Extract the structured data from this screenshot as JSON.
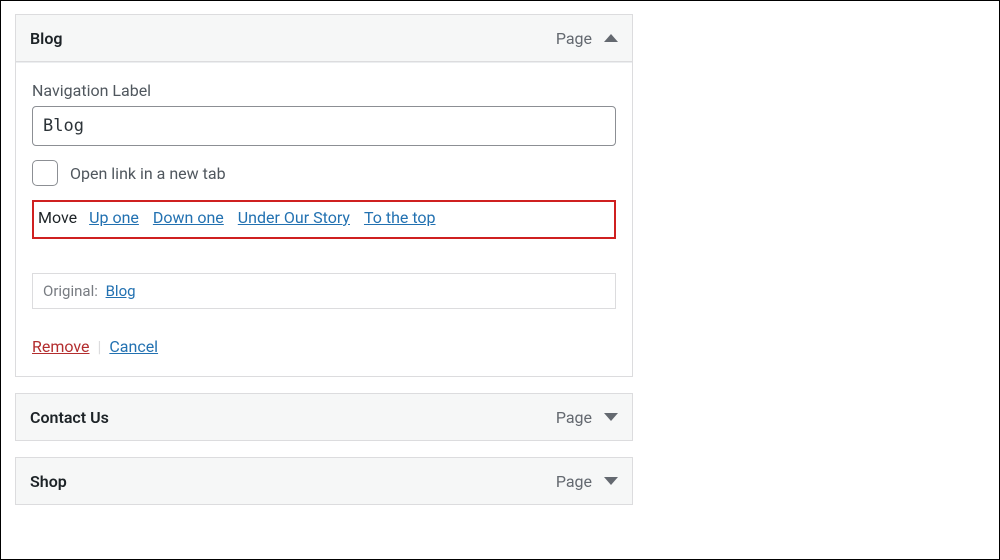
{
  "items": [
    {
      "title": "Blog",
      "type": "Page",
      "expanded": true,
      "nav_label_label": "Navigation Label",
      "nav_label_value": "Blog",
      "new_tab_label": "Open link in a new tab",
      "move_prefix": "Move",
      "move_links": {
        "up": "Up one",
        "down": "Down one",
        "under": "Under Our Story",
        "top": "To the top"
      },
      "original_prefix": "Original:",
      "original_value": "Blog",
      "remove": "Remove",
      "cancel": "Cancel"
    },
    {
      "title": "Contact Us",
      "type": "Page",
      "expanded": false
    },
    {
      "title": "Shop",
      "type": "Page",
      "expanded": false
    }
  ]
}
